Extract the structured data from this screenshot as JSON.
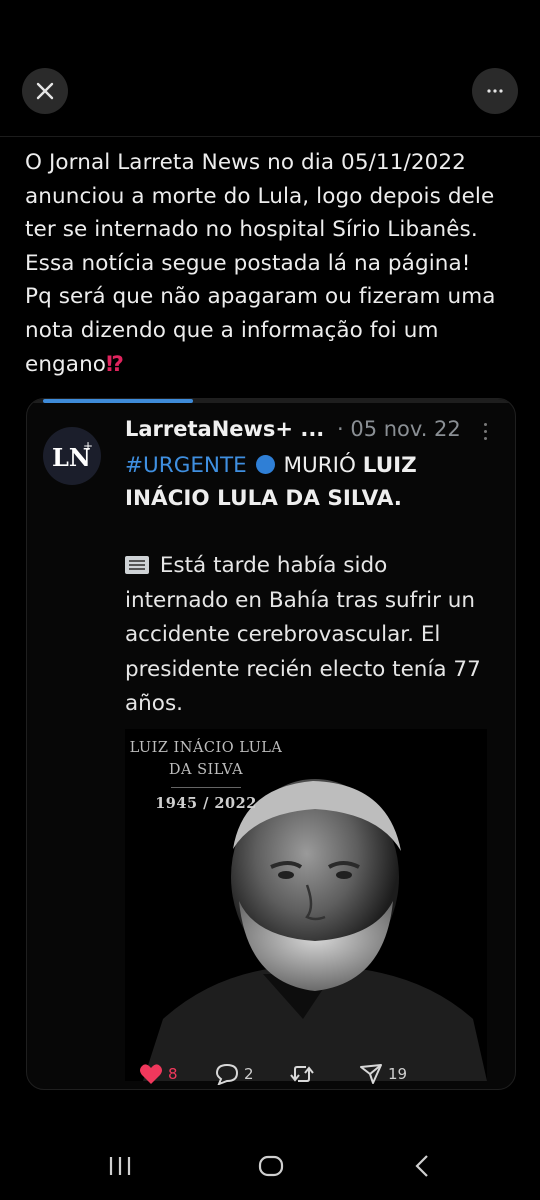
{
  "topbar": {
    "close_icon": "close-icon",
    "more_icon": "more-horizontal-icon"
  },
  "post": {
    "lines": [
      "O Jornal Larreta News no dia 05/11/2022",
      "anunciou a morte do Lula, logo depois dele",
      "ter se internado no hospital Sírio Libanês.",
      "Essa notícia segue postada lá na página!",
      "Pq será que não apagaram ou fizeram uma",
      "nota dizendo que a informação foi um",
      "engano"
    ],
    "end_glyph": "⁉"
  },
  "quoted": {
    "progress": 0.33,
    "avatar_text": "LN",
    "avatar_plus": "+",
    "author": "LarretaNews+ ...",
    "date": "· 05 nov. 22",
    "hashtag": "#URGENTE",
    "headline_a": "MURIÓ",
    "headline_b": "LUIZ",
    "headline_line2": "INÁCIO LULA DA SILVA.",
    "body_first": "Está tarde había sido",
    "body_lines": [
      "internado en Bahía tras sufrir un",
      "accidente cerebrovascular. El",
      "presidente recién electo tenía 77",
      "años."
    ],
    "image": {
      "name_line1": "LUIZ INÁCIO LULA",
      "name_line2": "DA SILVA",
      "years": "1945 / 2022"
    }
  },
  "actions": {
    "likes": "8",
    "replies": "2",
    "reposts": "",
    "views": "19"
  },
  "colors": {
    "accent": "#3e8bd9",
    "like": "#f0385c",
    "background": "#000000"
  }
}
